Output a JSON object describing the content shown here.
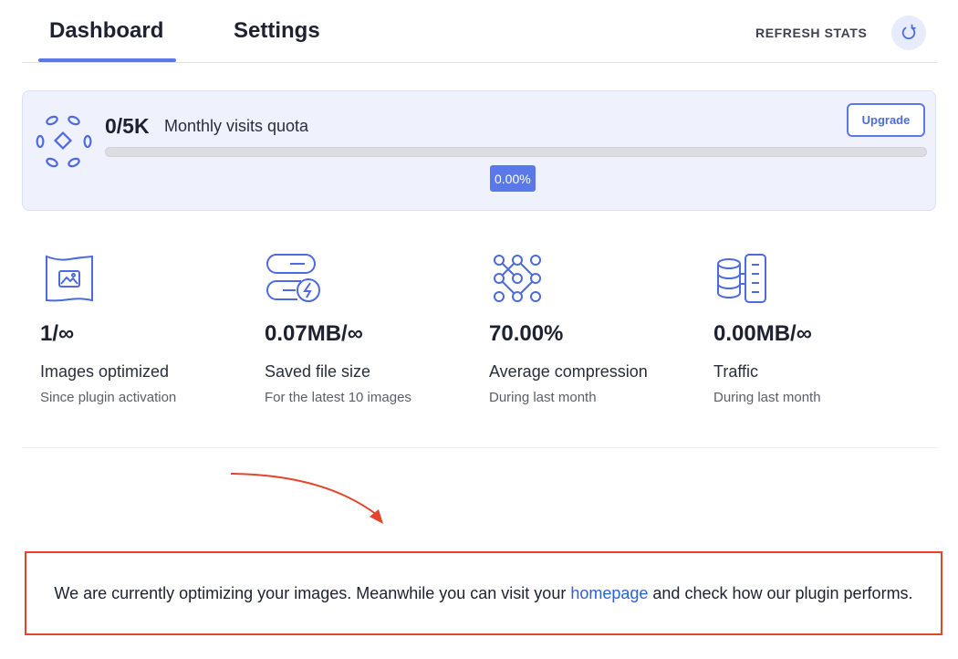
{
  "tabs": [
    {
      "label": "Dashboard",
      "active": true
    },
    {
      "label": "Settings",
      "active": false
    }
  ],
  "header": {
    "refresh_label": "REFRESH STATS",
    "refresh_icon": "refresh-icon"
  },
  "quota": {
    "value": "0/5K",
    "label": "Monthly visits quota",
    "upgrade_label": "Upgrade",
    "progress_percent": 0,
    "progress_text": "0.00%",
    "logo_icon": "quota-logo-icon"
  },
  "stats": [
    {
      "icon": "image-frame-icon",
      "value": "1/∞",
      "label": "Images optimized",
      "sub": "Since plugin activation"
    },
    {
      "icon": "storage-savings-icon",
      "value": "0.07MB/∞",
      "label": "Saved file size",
      "sub": "For the latest 10 images"
    },
    {
      "icon": "compression-nodes-icon",
      "value": "70.00%",
      "label": "Average compression",
      "sub": "During last month"
    },
    {
      "icon": "traffic-database-icon",
      "value": "0.00MB/∞",
      "label": "Traffic",
      "sub": "During last month"
    }
  ],
  "notice": {
    "text_before": "We are currently optimizing your images. Meanwhile you can visit your ",
    "link_text": "homepage",
    "text_after": " and check how our plugin performs."
  },
  "colors": {
    "accent": "#5a78e8",
    "card_bg": "#eff2fd",
    "annotation_red": "#e5442b",
    "link": "#2a63d4"
  }
}
